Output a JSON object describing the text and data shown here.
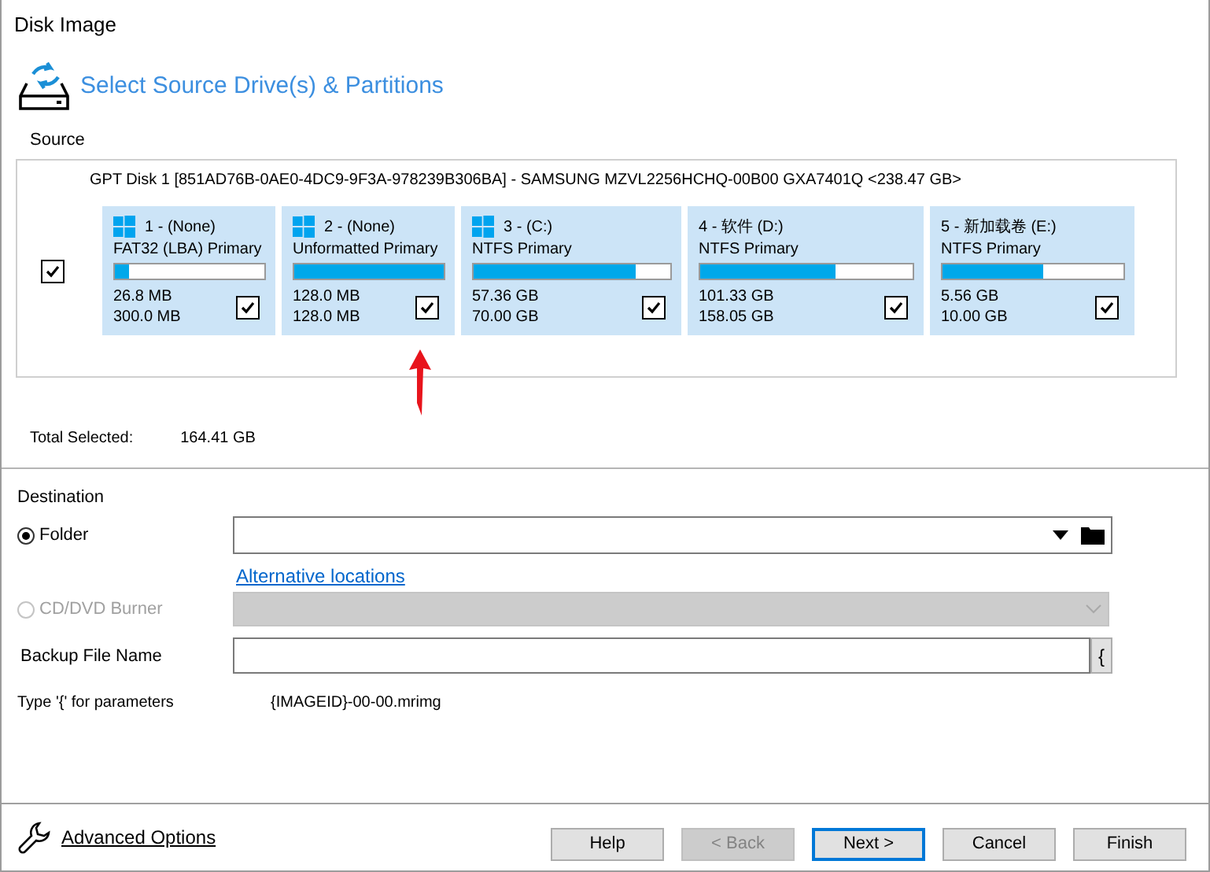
{
  "window": {
    "title": "Disk Image"
  },
  "header": {
    "title": "Select Source Drive(s) & Partitions"
  },
  "source": {
    "label": "Source",
    "disk": {
      "title": "GPT Disk 1 [851AD76B-0AE0-4DC9-9F3A-978239B306BA] - SAMSUNG MZVL2256HCHQ-00B00 GXA7401Q  <238.47 GB>",
      "checked": true,
      "partitions": [
        {
          "label": "1 -  (None)",
          "windows_logo": true,
          "type": "FAT32 (LBA) Primary",
          "level": 0.09,
          "used": "26.8 MB",
          "total": "300.0 MB",
          "checked": true
        },
        {
          "label": "2 -  (None)",
          "windows_logo": true,
          "type": "Unformatted Primary",
          "level": 1.0,
          "used": "128.0 MB",
          "total": "128.0 MB",
          "checked": true
        },
        {
          "label": "3 -  (C:)",
          "windows_logo": true,
          "type": "NTFS Primary",
          "level": 0.82,
          "used": "57.36 GB",
          "total": "70.00 GB",
          "checked": true
        },
        {
          "label": "4 - 软件 (D:)",
          "windows_logo": false,
          "type": "NTFS Primary",
          "level": 0.64,
          "used": "101.33 GB",
          "total": "158.05 GB",
          "checked": true
        },
        {
          "label": "5 - 新加载卷 (E:)",
          "windows_logo": false,
          "type": "NTFS Primary",
          "level": 0.56,
          "used": "5.56 GB",
          "total": "10.00 GB",
          "checked": true
        }
      ]
    },
    "total_label": "Total Selected:",
    "total_value": "164.41 GB"
  },
  "destination": {
    "label": "Destination",
    "options": [
      {
        "label": "Folder",
        "selected": true,
        "disabled": false
      },
      {
        "label": "CD/DVD Burner",
        "selected": false,
        "disabled": true
      }
    ],
    "alt_link": "Alternative locations",
    "file_name_label": "Backup File Name",
    "param_button": "{",
    "hint_label": "Type '{' for parameters",
    "hint_value": "{IMAGEID}-00-00.mrimg"
  },
  "footer": {
    "advanced": "Advanced Options",
    "buttons": [
      {
        "label": "Help",
        "disabled": false,
        "default": false
      },
      {
        "label": "< Back",
        "disabled": true,
        "default": false
      },
      {
        "label": "Next >",
        "disabled": false,
        "default": true
      },
      {
        "label": "Cancel",
        "disabled": false,
        "default": false
      },
      {
        "label": "Finish",
        "disabled": false,
        "default": false
      }
    ]
  }
}
